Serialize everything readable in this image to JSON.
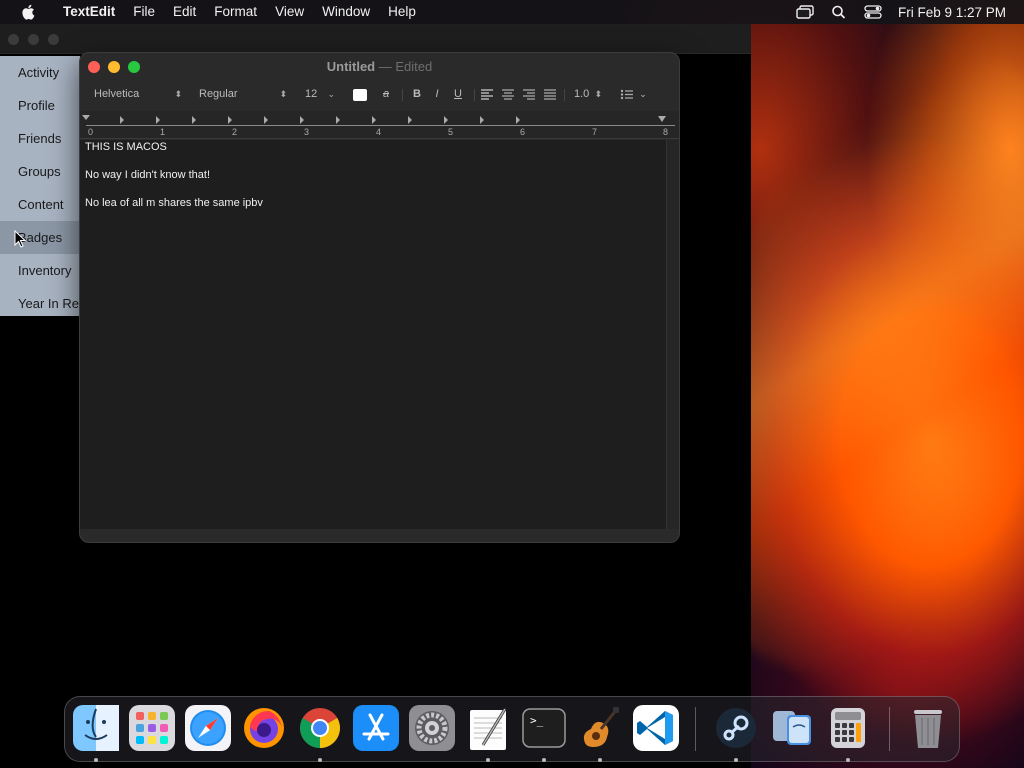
{
  "menubar": {
    "app_name": "TextEdit",
    "items": [
      "File",
      "Edit",
      "Format",
      "View",
      "Window",
      "Help"
    ],
    "datetime": "Fri Feb 9  1:27 PM",
    "status_icons": [
      "screen-mirroring-icon",
      "spotlight-search-icon",
      "control-center-icon"
    ]
  },
  "sidebar": {
    "items": [
      {
        "label": "Activity"
      },
      {
        "label": "Profile"
      },
      {
        "label": "Friends"
      },
      {
        "label": "Groups"
      },
      {
        "label": "Content"
      },
      {
        "label": "Badges",
        "active": true
      },
      {
        "label": "Inventory"
      },
      {
        "label": "Year In Re"
      }
    ]
  },
  "textedit": {
    "title": "Untitled",
    "title_separator": "—",
    "edited_label": "Edited",
    "toolbar": {
      "font_family": "Helvetica",
      "font_style": "Regular",
      "font_size": "12",
      "bold": "B",
      "italic": "I",
      "underline": "U",
      "line_spacing": "1.0",
      "text_color": "#ffffff"
    },
    "ruler_labels": [
      "0",
      "1",
      "2",
      "3",
      "4",
      "5",
      "6",
      "7",
      "8"
    ],
    "document_lines": [
      "THIS IS MACOS",
      "No way I didn't know that!",
      "No lea of all m shares the same ipbv"
    ]
  },
  "dock": {
    "apps": [
      {
        "name": "Finder",
        "icon": "finder-icon",
        "running": true
      },
      {
        "name": "Launchpad",
        "icon": "launchpad-icon",
        "running": false
      },
      {
        "name": "Safari",
        "icon": "safari-icon",
        "running": false
      },
      {
        "name": "Firefox",
        "icon": "firefox-icon",
        "running": false
      },
      {
        "name": "Chrome",
        "icon": "chrome-icon",
        "running": true
      },
      {
        "name": "App Store",
        "icon": "app-store-icon",
        "running": false
      },
      {
        "name": "System Settings",
        "icon": "system-settings-icon",
        "running": false
      },
      {
        "name": "TextEdit",
        "icon": "textedit-icon",
        "running": true
      },
      {
        "name": "Terminal",
        "icon": "terminal-icon",
        "running": true
      },
      {
        "name": "GarageBand",
        "icon": "garageband-icon",
        "running": true
      },
      {
        "name": "Visual Studio Code",
        "icon": "vscode-icon",
        "running": false
      },
      {
        "name": "Steam",
        "icon": "steam-icon",
        "running": true
      },
      {
        "name": "Migration Assistant",
        "icon": "migration-assistant-icon",
        "running": false
      },
      {
        "name": "Calculator",
        "icon": "calculator-icon",
        "running": true
      },
      {
        "name": "Trash",
        "icon": "trash-icon",
        "running": false
      }
    ]
  }
}
